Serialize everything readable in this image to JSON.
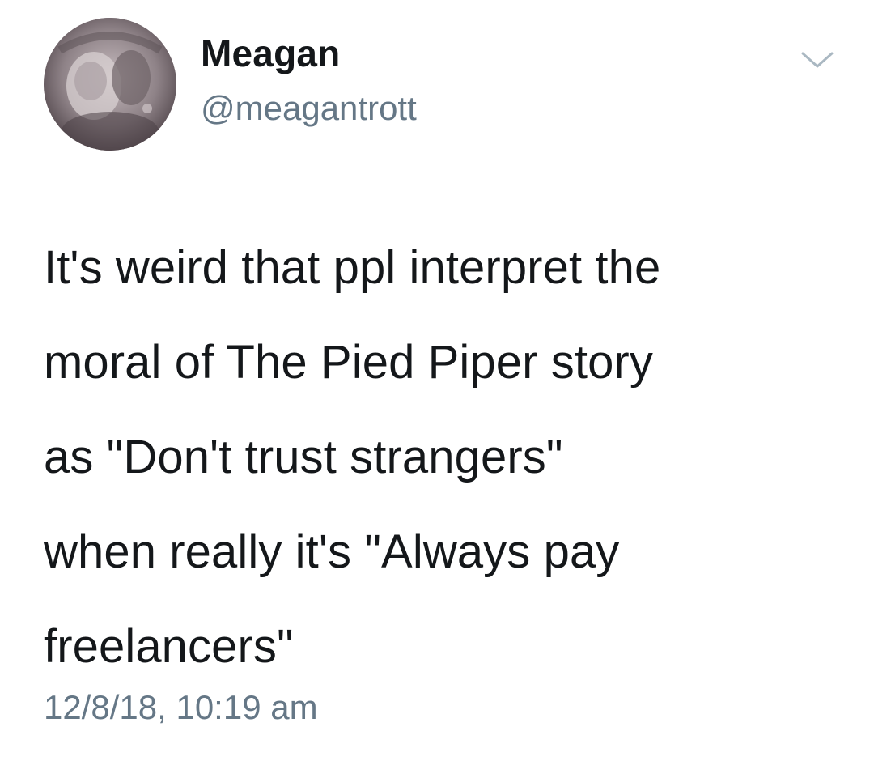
{
  "author": {
    "display_name": "Meagan",
    "handle": "@meagantrott"
  },
  "tweet": {
    "text": "It's weird that ppl interpret the\nmoral of The Pied Piper story\nas \"Don't trust strangers\"\nwhen really it's \"Always pay\nfreelancers\"",
    "timestamp": "12/8/18, 10:19 am"
  },
  "icons": {
    "menu": "chevron-down-icon",
    "avatar": "profile-picture"
  },
  "colors": {
    "text_primary": "#14171a",
    "text_secondary": "#657786",
    "background": "#ffffff"
  }
}
